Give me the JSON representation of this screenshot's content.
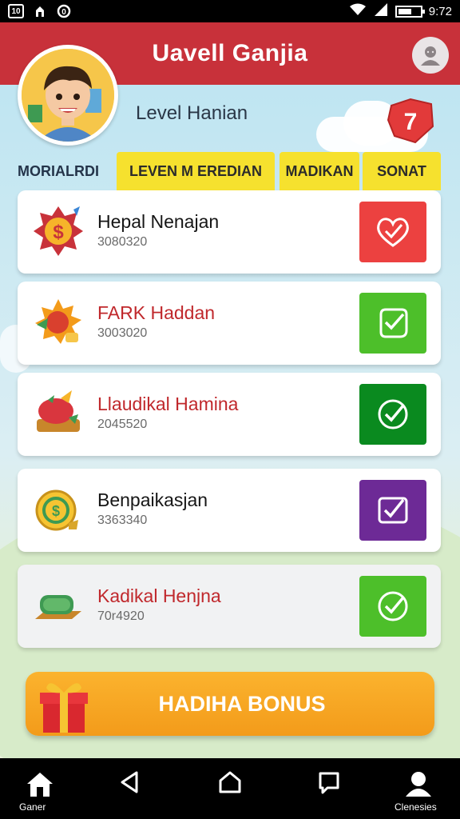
{
  "status_bar": {
    "left_icons": [
      "sim-icon",
      "notification-icon",
      "sync-icon"
    ],
    "left_texts": [
      "10",
      "",
      "0"
    ],
    "time": "9:72"
  },
  "header": {
    "title": "Uavell Ganjia"
  },
  "profile": {
    "level_label": "Level Hanian",
    "badge_number": "7"
  },
  "tabs": [
    {
      "label": "MORIALRDI"
    },
    {
      "label": "LEVEN M EREDIAN"
    },
    {
      "label": "MADIKAN"
    },
    {
      "label": "SONAT"
    }
  ],
  "items": [
    {
      "title": "Hepal Nenajan",
      "subtitle": "3080320",
      "title_color": "black",
      "check_color": "#ec4140",
      "icon": "dollar-badge-icon",
      "check_icon": "heart-check-icon"
    },
    {
      "title": "FARK Haddan",
      "subtitle": "3003020",
      "title_color": "red",
      "check_color": "#4dbf2a",
      "icon": "sun-coin-icon",
      "check_icon": "check-icon"
    },
    {
      "title": "Llaudikal Hamina",
      "subtitle": "2045520",
      "title_color": "red",
      "check_color": "#0a8a1f",
      "icon": "fruit-basket-icon",
      "check_icon": "check-icon"
    },
    {
      "title": "Benpaikasjan",
      "subtitle": "3363340",
      "title_color": "black",
      "check_color": "#6d2a96",
      "icon": "gold-coin-icon",
      "check_icon": "check-icon"
    },
    {
      "title": "Kadikal Henjna",
      "subtitle": "70r4920",
      "title_color": "red",
      "check_color": "#4dbf2a",
      "icon": "cash-stack-icon",
      "check_icon": "check-icon"
    }
  ],
  "bonus": {
    "label": "HADIHA BONUS"
  },
  "nav": {
    "home_label": "Ganer",
    "profile_label": "Clenesies"
  },
  "colors": {
    "header": "#c8313a",
    "tab_yellow": "#f6e12e",
    "bonus_orange": "#f7a624"
  }
}
